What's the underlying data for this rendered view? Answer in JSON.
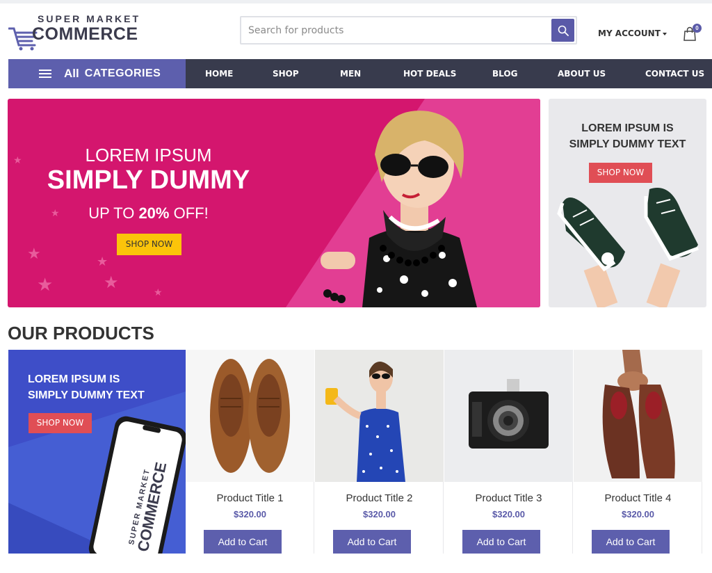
{
  "header": {
    "logo_super": "SUPER MARKET",
    "logo_commerce": "COMMERCE",
    "search_placeholder": "Search for products",
    "account_label": "MY ACCOUNT",
    "cart_count": "0"
  },
  "nav": {
    "all_label": "All",
    "categories_label": "CATEGORIES",
    "items": [
      "HOME",
      "SHOP",
      "MEN",
      "HOT DEALS",
      "BLOG",
      "ABOUT US",
      "CONTACT US"
    ]
  },
  "hero": {
    "line1": "LOREM IPSUM",
    "line2": "SIMPLY DUMMY",
    "line3_prefix": "UP TO ",
    "line3_bold": "20%",
    "line3_suffix": " OFF!",
    "button": "SHOP NOW"
  },
  "side_banner": {
    "line1": "LOREM IPSUM IS",
    "line2": "SIMPLY DUMMY TEXT",
    "button": "SHOP NOW"
  },
  "products_title": "OUR PRODUCTS",
  "promo": {
    "line1": "LOREM IPSUM IS",
    "line2": "SIMPLY DUMMY TEXT",
    "button": "SHOP NOW",
    "phone_super": "SUPER MARKET",
    "phone_commerce": "COMMERCE"
  },
  "products": [
    {
      "title": "Product Title 1",
      "price": "$320.00",
      "button": "Add to Cart"
    },
    {
      "title": "Product Title 2",
      "price": "$320.00",
      "button": "Add to Cart"
    },
    {
      "title": "Product Title 3",
      "price": "$320.00",
      "button": "Add to Cart"
    },
    {
      "title": "Product Title 4",
      "price": "$320.00",
      "button": "Add to Cart"
    }
  ],
  "colors": {
    "brand": "#5d5fad",
    "nav_bg": "#383b4d",
    "hero_bg": "#d4166e",
    "cta_yellow": "#fbc40a",
    "cta_red": "#e04e55"
  }
}
